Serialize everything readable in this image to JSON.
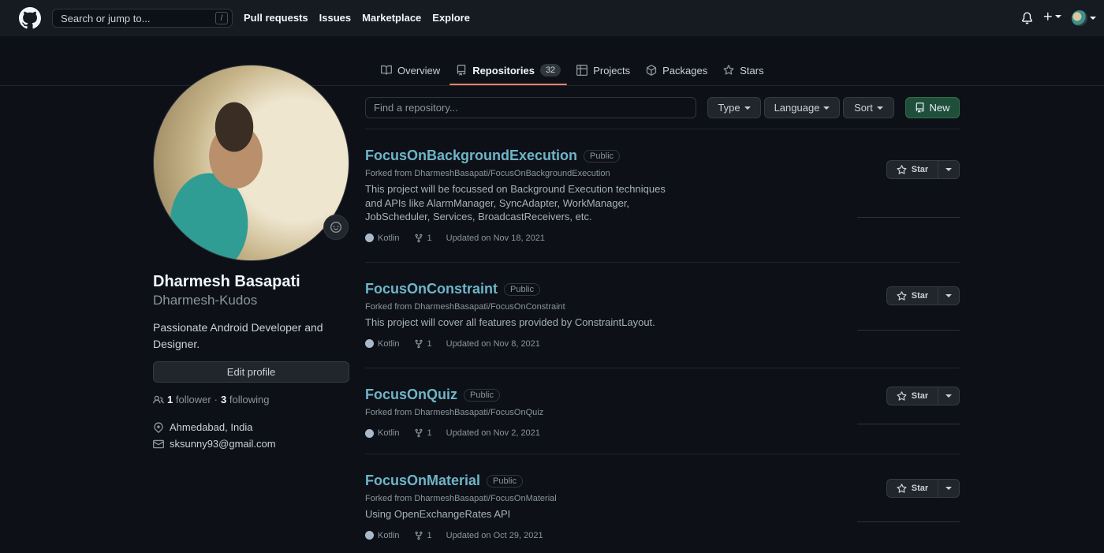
{
  "header": {
    "search_placeholder": "Search or jump to...",
    "search_shortcut": "/",
    "nav": [
      "Pull requests",
      "Issues",
      "Marketplace",
      "Explore"
    ]
  },
  "tabs": [
    {
      "label": "Overview",
      "icon": "book-icon"
    },
    {
      "label": "Repositories",
      "icon": "repo-icon",
      "count": "32",
      "active": true
    },
    {
      "label": "Projects",
      "icon": "project-icon"
    },
    {
      "label": "Packages",
      "icon": "package-icon"
    },
    {
      "label": "Stars",
      "icon": "star-icon"
    }
  ],
  "profile": {
    "name": "Dharmesh Basapati",
    "login": "Dharmesh-Kudos",
    "bio": "Passionate Android Developer and Designer.",
    "edit_label": "Edit profile",
    "followers": "1",
    "followers_label": "follower",
    "following": "3",
    "following_label": "following",
    "location": "Ahmedabad, India",
    "email": "sksunny93@gmail.com"
  },
  "filters": {
    "find_placeholder": "Find a repository...",
    "type": "Type",
    "language": "Language",
    "sort": "Sort",
    "new": "New"
  },
  "repos": [
    {
      "name": "FocusOnBackgroundExecution",
      "visibility": "Public",
      "forked": "Forked from DharmeshBasapati/FocusOnBackgroundExecution",
      "description": "This project will be focussed on Background Execution techniques and APIs like AlarmManager, SyncAdapter, WorkManager, JobScheduler, Services, BroadcastReceivers, etc.",
      "language": "Kotlin",
      "forks": "1",
      "updated": "Updated on Nov 18, 2021",
      "star_label": "Star"
    },
    {
      "name": "FocusOnConstraint",
      "visibility": "Public",
      "forked": "Forked from DharmeshBasapati/FocusOnConstraint",
      "description": "This project will cover all features provided by ConstraintLayout.",
      "language": "Kotlin",
      "forks": "1",
      "updated": "Updated on Nov 8, 2021",
      "star_label": "Star"
    },
    {
      "name": "FocusOnQuiz",
      "visibility": "Public",
      "forked": "Forked from DharmeshBasapati/FocusOnQuiz",
      "description": "",
      "language": "Kotlin",
      "forks": "1",
      "updated": "Updated on Nov 2, 2021",
      "star_label": "Star"
    },
    {
      "name": "FocusOnMaterial",
      "visibility": "Public",
      "forked": "Forked from DharmeshBasapati/FocusOnMaterial",
      "description": "Using OpenExchangeRates API",
      "language": "Kotlin",
      "forks": "1",
      "updated": "Updated on Oct 29, 2021",
      "star_label": "Star"
    }
  ],
  "colors": {
    "background": "#0d1117",
    "header": "#161b22",
    "link": "#6fb4c9",
    "tab_underline": "#f78166",
    "kotlin": "#a8b9cc"
  }
}
